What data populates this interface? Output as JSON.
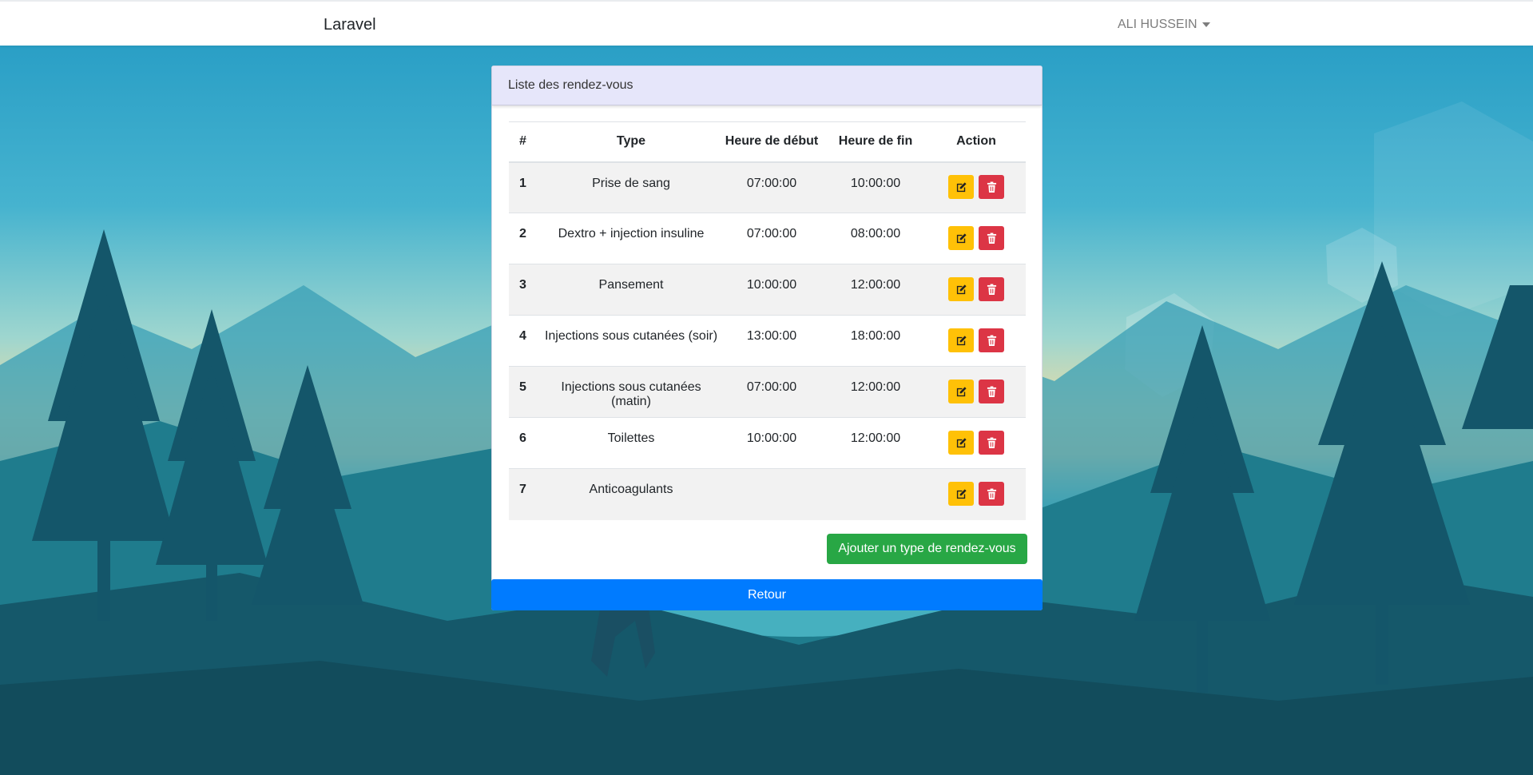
{
  "navbar": {
    "brand": "Laravel",
    "user_name": "ALI HUSSEIN"
  },
  "card": {
    "title": "Liste des rendez-vous",
    "columns": [
      "#",
      "Type",
      "Heure de début",
      "Heure de fin",
      "Action"
    ],
    "rows": [
      {
        "num": "1",
        "type": "Prise de sang",
        "start": "07:00:00",
        "end": "10:00:00"
      },
      {
        "num": "2",
        "type": "Dextro + injection insuline",
        "start": "07:00:00",
        "end": "08:00:00"
      },
      {
        "num": "3",
        "type": "Pansement",
        "start": "10:00:00",
        "end": "12:00:00"
      },
      {
        "num": "4",
        "type": "Injections sous cutanées (soir)",
        "start": "13:00:00",
        "end": "18:00:00"
      },
      {
        "num": "5",
        "type": "Injections sous cutanées (matin)",
        "start": "07:00:00",
        "end": "12:00:00"
      },
      {
        "num": "6",
        "type": "Toilettes",
        "start": "10:00:00",
        "end": "12:00:00"
      },
      {
        "num": "7",
        "type": "Anticoagulants",
        "start": "",
        "end": ""
      }
    ],
    "add_button": "Ajouter un type de rendez-vous",
    "back_button": "Retour"
  },
  "icons": {
    "edit": "edit-icon",
    "delete": "trash-icon",
    "dropdown": "caret-down-icon"
  },
  "colors": {
    "header_bg": "#e6e6fa",
    "edit": "#ffc107",
    "delete": "#dc3545",
    "add": "#28a745",
    "back": "#007bff"
  }
}
